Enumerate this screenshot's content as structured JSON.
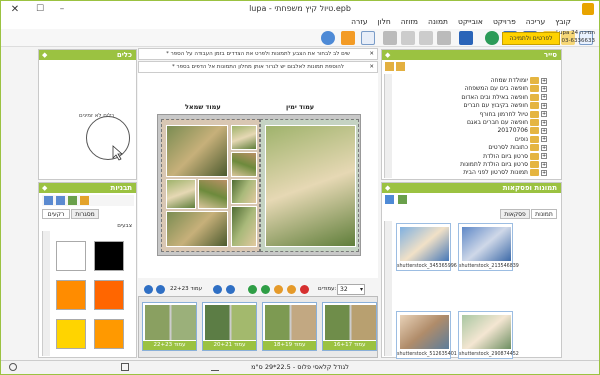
{
  "window": {
    "title": "lupa - טיול קיץ משפחתי.epb",
    "close_glyph": "✕",
    "max_glyph": "☐",
    "min_glyph": "–"
  },
  "menu": [
    "קובץ",
    "עריכה",
    "פרויקט",
    "אובייקט",
    "תמונה",
    "מזוזה",
    "חלון",
    "עזרה"
  ],
  "brand": {
    "badge": "לפרטים ולתמיכה",
    "line1": "Lupa 24 תמיכה",
    "line2": "03-6336633"
  },
  "left_top_panel": {
    "title": "כלים",
    "empty_text": "כלים לא זמינים"
  },
  "left_bottom_panel": {
    "title": "תבניות",
    "tabs": [
      "רקעים",
      "מסגרות"
    ],
    "sub_label": "צבעים",
    "swatches": [
      "#000000",
      "#ffffff",
      "#ff6600",
      "#ff8c00",
      "#ff9900",
      "#ffd400"
    ]
  },
  "notices": [
    "* שים לב לבחור את הצבע לתמונות ולפרט את הצדדים בזמן העבודה על הספר",
    "* להוספת תמונות לאלבום יש לגרור אותן מחלון התמונות אל הדפים בספר"
  ],
  "editor": {
    "left_label": "עמוד שמאל",
    "right_label": "עמוד ימין"
  },
  "filmstrip": {
    "pages_label": "עמודים:",
    "pages_value": "32",
    "spread_label": "עמוד 22+23",
    "thumbs": [
      "עמוד 22+23",
      "עמוד 20+21",
      "עמוד 18+19",
      "עמוד 16+17"
    ]
  },
  "right_top_panel": {
    "title": "סייר",
    "tree": [
      "יומולדת שמחה",
      "חופשה בים עם המשפחה",
      "חופשה באילת ובים האדום",
      "חופשה בקיבוץ עם חברים",
      "טיול לחרמון בחורף",
      "חופשה עם חברים באגם",
      "20170706",
      "נופים",
      "כתובות לסרטים",
      "סרטון ביום הולדת",
      "סרטון ביום הולדת לתמונות",
      "תמונות לסרטון לפני הבית"
    ]
  },
  "right_bottom_panel": {
    "title": "תמונות ופסקאות",
    "tabs": [
      "תמונות",
      "פסקאות"
    ],
    "photos": [
      {
        "name": "shutterstock_213546839"
      },
      {
        "name": "shutterstock_345365996"
      },
      {
        "name": "shutterstock_290874452"
      },
      {
        "name": "shutterstock_512635401"
      }
    ]
  },
  "status": {
    "text": "לגודל קלאסי פלוס - 22.5*29 ס\"מ"
  }
}
